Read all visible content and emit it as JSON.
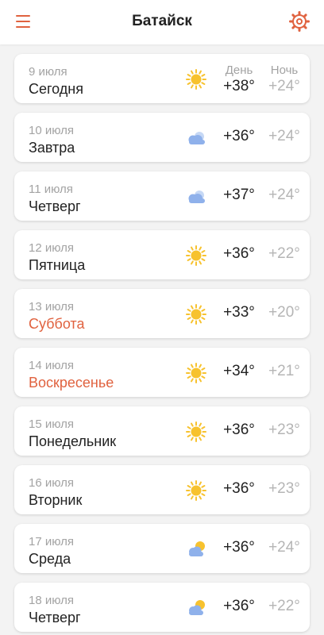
{
  "header": {
    "title": "Батайск",
    "menu_icon": "hamburger-menu-icon",
    "settings_icon": "gear-icon",
    "accent_color": "#e0623f"
  },
  "columns": {
    "day_label": "День",
    "night_label": "Ночь"
  },
  "days": [
    {
      "date": "9 июля",
      "name": "Сегодня",
      "icon": "sun-icon",
      "day": "+38°",
      "night": "+24°",
      "weekend": false
    },
    {
      "date": "10 июля",
      "name": "Завтра",
      "icon": "cloud-icon",
      "day": "+36°",
      "night": "+24°",
      "weekend": false
    },
    {
      "date": "11 июля",
      "name": "Четверг",
      "icon": "cloud-icon",
      "day": "+37°",
      "night": "+24°",
      "weekend": false
    },
    {
      "date": "12 июля",
      "name": "Пятница",
      "icon": "sun-icon",
      "day": "+36°",
      "night": "+22°",
      "weekend": false
    },
    {
      "date": "13 июля",
      "name": "Суббота",
      "icon": "sun-icon",
      "day": "+33°",
      "night": "+20°",
      "weekend": true
    },
    {
      "date": "14 июля",
      "name": "Воскресенье",
      "icon": "sun-icon",
      "day": "+34°",
      "night": "+21°",
      "weekend": true
    },
    {
      "date": "15 июля",
      "name": "Понедельник",
      "icon": "sun-icon",
      "day": "+36°",
      "night": "+23°",
      "weekend": false
    },
    {
      "date": "16 июля",
      "name": "Вторник",
      "icon": "sun-icon",
      "day": "+36°",
      "night": "+23°",
      "weekend": false
    },
    {
      "date": "17 июля",
      "name": "Среда",
      "icon": "partly-cloudy-icon",
      "day": "+36°",
      "night": "+24°",
      "weekend": false
    },
    {
      "date": "18 июля",
      "name": "Четверг",
      "icon": "partly-cloudy-icon",
      "day": "+36°",
      "night": "+22°",
      "weekend": false
    }
  ]
}
